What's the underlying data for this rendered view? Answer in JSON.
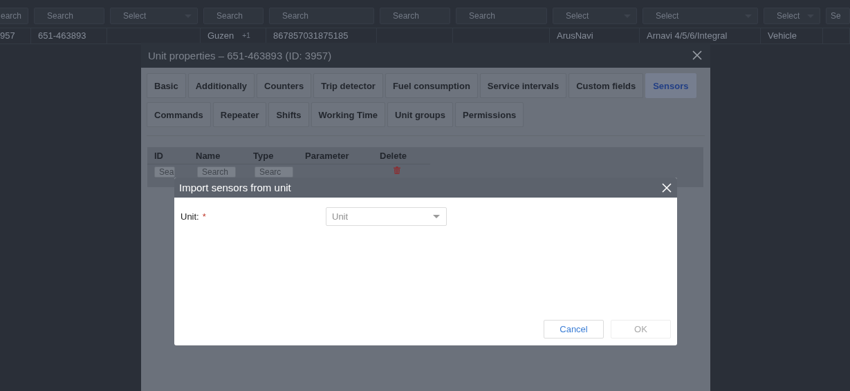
{
  "background_table": {
    "filters": [
      {
        "kind": "search",
        "placeholder": "earch"
      },
      {
        "kind": "search",
        "placeholder": "Search"
      },
      {
        "kind": "select",
        "placeholder": "Select"
      },
      {
        "kind": "search",
        "placeholder": "Search"
      },
      {
        "kind": "search",
        "placeholder": "Search"
      },
      {
        "kind": "search",
        "placeholder": "Search"
      },
      {
        "kind": "search",
        "placeholder": "Search"
      },
      {
        "kind": "select",
        "placeholder": "Select"
      },
      {
        "kind": "select",
        "placeholder": "Select"
      },
      {
        "kind": "select",
        "placeholder": "Select"
      },
      {
        "kind": "search",
        "placeholder": "Se"
      }
    ],
    "row": [
      {
        "kind": "text",
        "text": "957"
      },
      {
        "kind": "text",
        "text": "651-463893"
      },
      {
        "kind": "blank"
      },
      {
        "kind": "text",
        "text": "Guzen",
        "badge": "+1"
      },
      {
        "kind": "text",
        "text": "867857031875185"
      },
      {
        "kind": "blank"
      },
      {
        "kind": "blank"
      },
      {
        "kind": "text",
        "text": "ArusNavi"
      },
      {
        "kind": "text",
        "text": "Arnavi 4/5/6/Integral"
      },
      {
        "kind": "text",
        "text": "Vehicle"
      },
      {
        "kind": "blank"
      }
    ]
  },
  "unit_properties": {
    "title": "Unit properties – 651-463893 (ID: 3957)",
    "tab_rows": [
      [
        {
          "label": "Basic",
          "selected": false
        },
        {
          "label": "Additionally",
          "selected": false
        },
        {
          "label": "Counters",
          "selected": false
        },
        {
          "label": "Trip detector",
          "selected": false
        },
        {
          "label": "Fuel consumption",
          "selected": false
        },
        {
          "label": "Service intervals",
          "selected": false
        },
        {
          "label": "Custom fields",
          "selected": false
        },
        {
          "label": "Sensors",
          "selected": true
        }
      ],
      [
        {
          "label": "Commands",
          "selected": false
        },
        {
          "label": "Repeater",
          "selected": false
        },
        {
          "label": "Shifts",
          "selected": false
        },
        {
          "label": "Working Time",
          "selected": false
        },
        {
          "label": "Unit groups",
          "selected": false
        },
        {
          "label": "Permissions",
          "selected": false
        }
      ]
    ],
    "sensors_table": {
      "columns": [
        {
          "label": "ID",
          "filter": "Sea"
        },
        {
          "label": "Name",
          "filter": "Search"
        },
        {
          "label": "Type",
          "filter": "Searc"
        },
        {
          "label": "Parameter"
        },
        {
          "label": "Delete"
        }
      ]
    }
  },
  "import_dialog": {
    "title": "Import sensors from unit",
    "field": {
      "label": "Unit:",
      "required_mark": "*",
      "placeholder": "Unit"
    },
    "buttons": [
      {
        "label": "Cancel",
        "disabled": false
      },
      {
        "label": "OK",
        "disabled": true
      }
    ]
  }
}
